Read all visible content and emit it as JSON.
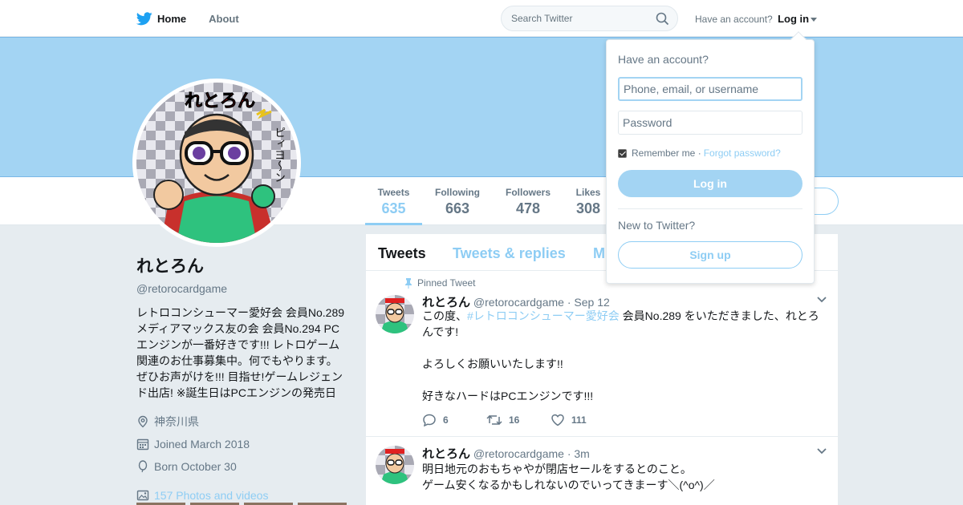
{
  "nav": {
    "home": "Home",
    "about": "About"
  },
  "search": {
    "placeholder": "Search Twitter"
  },
  "account": {
    "prompt": "Have an account?",
    "login": "Log in"
  },
  "avatar_art": {
    "text_top": "れとろん",
    "text_side": "ピィヨ〜ン"
  },
  "stats": [
    {
      "label": "Tweets",
      "value": "635"
    },
    {
      "label": "Following",
      "value": "663"
    },
    {
      "label": "Followers",
      "value": "478"
    },
    {
      "label": "Likes",
      "value": "308"
    }
  ],
  "profile": {
    "name": "れとろん",
    "handle": "@retorocardgame",
    "bio": "レトロコンシューマー愛好会 会員No.289 メディアマックス友の会 会員No.294 PCエンジンが一番好きです!!! レトロゲーム関連のお仕事募集中。何でもやります。ぜひお声がけを!!! 目指せ!ゲームレジェンド出店! ※誕生日はPCエンジンの発売日",
    "location": "神奈川県",
    "joined": "Joined March 2018",
    "born": "Born October 30",
    "photos": "157 Photos and videos"
  },
  "tabs": [
    "Tweets",
    "Tweets & replies",
    "M"
  ],
  "tweets": [
    {
      "pinned_label": "Pinned Tweet",
      "name": "れとろん",
      "handle": "@retorocardgame",
      "time": "· Sep 12",
      "text_pre": "この度、",
      "hashtag": "#レトロコンシューマー愛好会",
      "text_post": " 会員No.289 をいただきました、れとろんです!\n\nよろしくお願いいたします!!\n\n好きなハードはPCエンジンです!!!",
      "replies": "6",
      "retweets": "16",
      "likes": "111"
    },
    {
      "name": "れとろん",
      "handle": "@retorocardgame",
      "time": "· 3m",
      "text": "明日地元のおもちゃやが閉店セールをするとのこと。\nゲーム安くなるかもしれないのでいってきまーす＼(^o^)／"
    }
  ],
  "login_dropdown": {
    "title": "Have an account?",
    "username_placeholder": "Phone, email, or username",
    "password_placeholder": "Password",
    "remember": "Remember me",
    "separator": "·",
    "forgot": "Forgot password?",
    "login_button": "Log in",
    "new_prompt": "New to Twitter?",
    "signup_button": "Sign up"
  },
  "colors": {
    "brand": "#1da1f2",
    "banner": "#a3d4f3",
    "accent_light": "#8ecdf4",
    "text_secondary": "#657786"
  }
}
